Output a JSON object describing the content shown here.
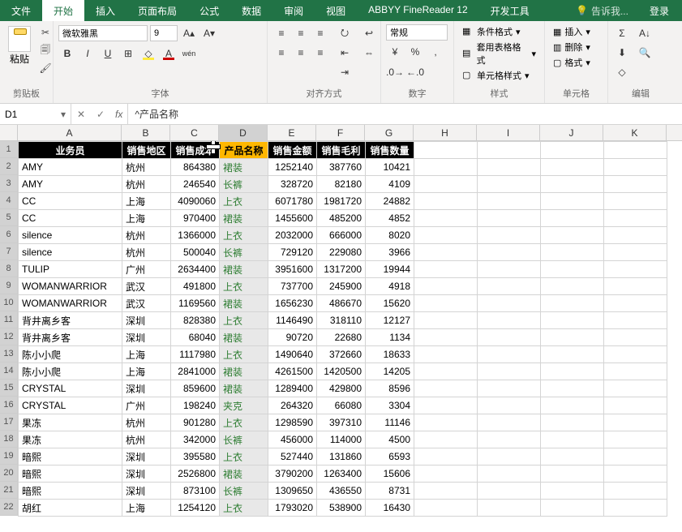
{
  "ribbon": {
    "tabs": [
      "文件",
      "开始",
      "插入",
      "页面布局",
      "公式",
      "数据",
      "审阅",
      "视图",
      "ABBYY FineReader 12",
      "开发工具"
    ],
    "active_tab": "开始",
    "tell_me": "告诉我...",
    "login": "登录",
    "groups": {
      "clipboard": {
        "label": "剪贴板",
        "paste": "粘贴"
      },
      "font": {
        "label": "字体",
        "font_name": "微软雅黑",
        "font_size": "9"
      },
      "alignment": {
        "label": "对齐方式"
      },
      "number": {
        "label": "数字",
        "format": "常规"
      },
      "styles": {
        "label": "样式",
        "cond_fmt": "条件格式",
        "table_fmt": "套用表格格式",
        "cell_styles": "单元格样式"
      },
      "cells": {
        "label": "单元格",
        "insert": "插入",
        "delete": "删除",
        "format": "格式"
      },
      "editing": {
        "label": "编辑"
      }
    }
  },
  "formula_bar": {
    "name_box": "D1",
    "fx": "fx",
    "value": "^产品名称"
  },
  "columns": [
    "A",
    "B",
    "C",
    "D",
    "E",
    "F",
    "G",
    "H",
    "I",
    "J",
    "K"
  ],
  "selected_col_index": 3,
  "headers": [
    "业务员",
    "销售地区",
    "销售成本",
    "产品名称",
    "销售金额",
    "销售毛利",
    "销售数量"
  ],
  "rows": [
    {
      "a": "AMY",
      "b": "杭州",
      "c": 864380,
      "d": "裙装",
      "e": 1252140,
      "f": 387760,
      "g": 10421
    },
    {
      "a": "AMY",
      "b": "杭州",
      "c": 246540,
      "d": "长裤",
      "e": 328720,
      "f": 82180,
      "g": 4109
    },
    {
      "a": "CC",
      "b": "上海",
      "c": 4090060,
      "d": "上衣",
      "e": 6071780,
      "f": 1981720,
      "g": 24882
    },
    {
      "a": "CC",
      "b": "上海",
      "c": 970400,
      "d": "裙装",
      "e": 1455600,
      "f": 485200,
      "g": 4852
    },
    {
      "a": "silence",
      "b": "杭州",
      "c": 1366000,
      "d": "上衣",
      "e": 2032000,
      "f": 666000,
      "g": 8020
    },
    {
      "a": "silence",
      "b": "杭州",
      "c": 500040,
      "d": "长裤",
      "e": 729120,
      "f": 229080,
      "g": 3966
    },
    {
      "a": "TULIP",
      "b": "广州",
      "c": 2634400,
      "d": "裙装",
      "e": 3951600,
      "f": 1317200,
      "g": 19944
    },
    {
      "a": "WOMANWARRIOR",
      "b": "武汉",
      "c": 491800,
      "d": "上衣",
      "e": 737700,
      "f": 245900,
      "g": 4918
    },
    {
      "a": "WOMANWARRIOR",
      "b": "武汉",
      "c": 1169560,
      "d": "裙装",
      "e": 1656230,
      "f": 486670,
      "g": 15620
    },
    {
      "a": "背井离乡客",
      "b": "深圳",
      "c": 828380,
      "d": "上衣",
      "e": 1146490,
      "f": 318110,
      "g": 12127
    },
    {
      "a": "背井离乡客",
      "b": "深圳",
      "c": 68040,
      "d": "裙装",
      "e": 90720,
      "f": 22680,
      "g": 1134
    },
    {
      "a": "陈小小爬",
      "b": "上海",
      "c": 1117980,
      "d": "上衣",
      "e": 1490640,
      "f": 372660,
      "g": 18633
    },
    {
      "a": "陈小小爬",
      "b": "上海",
      "c": 2841000,
      "d": "裙装",
      "e": 4261500,
      "f": 1420500,
      "g": 14205
    },
    {
      "a": "CRYSTAL",
      "b": "深圳",
      "c": 859600,
      "d": "裙装",
      "e": 1289400,
      "f": 429800,
      "g": 8596
    },
    {
      "a": "CRYSTAL",
      "b": "广州",
      "c": 198240,
      "d": "夹克",
      "e": 264320,
      "f": 66080,
      "g": 3304
    },
    {
      "a": "果冻",
      "b": "杭州",
      "c": 901280,
      "d": "上衣",
      "e": 1298590,
      "f": 397310,
      "g": 11146
    },
    {
      "a": "果冻",
      "b": "杭州",
      "c": 342000,
      "d": "长裤",
      "e": 456000,
      "f": 114000,
      "g": 4500
    },
    {
      "a": "暗熙",
      "b": "深圳",
      "c": 395580,
      "d": "上衣",
      "e": 527440,
      "f": 131860,
      "g": 6593
    },
    {
      "a": "暗熙",
      "b": "深圳",
      "c": 2526800,
      "d": "裙装",
      "e": 3790200,
      "f": 1263400,
      "g": 15606
    },
    {
      "a": "暗熙",
      "b": "深圳",
      "c": 873100,
      "d": "长裤",
      "e": 1309650,
      "f": 436550,
      "g": 8731
    },
    {
      "a": "胡红",
      "b": "上海",
      "c": 1254120,
      "d": "上衣",
      "e": 1793020,
      "f": 538900,
      "g": 16430
    }
  ]
}
